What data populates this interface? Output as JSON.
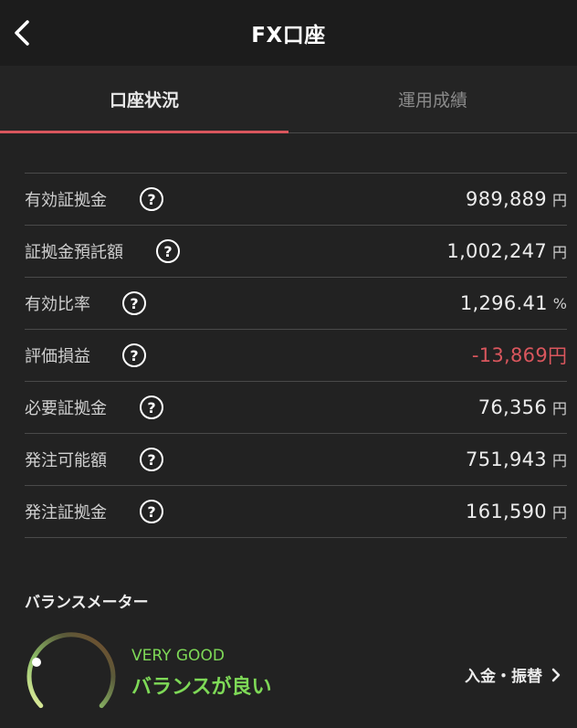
{
  "header": {
    "title": "FX口座",
    "back_icon": "chevron-left-icon"
  },
  "tabs": [
    {
      "label": "口座状況",
      "active": true
    },
    {
      "label": "運用成績",
      "active": false
    }
  ],
  "rows": [
    {
      "label": "有効証拠金",
      "value": "989,889",
      "unit": "円"
    },
    {
      "label": "証拠金預託額",
      "value": "1,002,247",
      "unit": "円"
    },
    {
      "label": "有効比率",
      "value": "1,296.41",
      "unit": "%"
    },
    {
      "label": "評価損益",
      "value": "-13,869",
      "unit": "円",
      "negative": true
    },
    {
      "label": "必要証拠金",
      "value": "76,356",
      "unit": "円"
    },
    {
      "label": "発注可能額",
      "value": "751,943",
      "unit": "円"
    },
    {
      "label": "発注証拠金",
      "value": "161,590",
      "unit": "円"
    }
  ],
  "help_icon_glyph": "?",
  "balance": {
    "title": "バランスメーター",
    "status_en": "VERY GOOD",
    "status_ja": "バランスが良い",
    "level": 0.9,
    "link_label": "入金・振替"
  },
  "colors": {
    "accent": "#d9565d",
    "negative": "#d9565d",
    "good": "#7ed957",
    "background": "#222222"
  }
}
